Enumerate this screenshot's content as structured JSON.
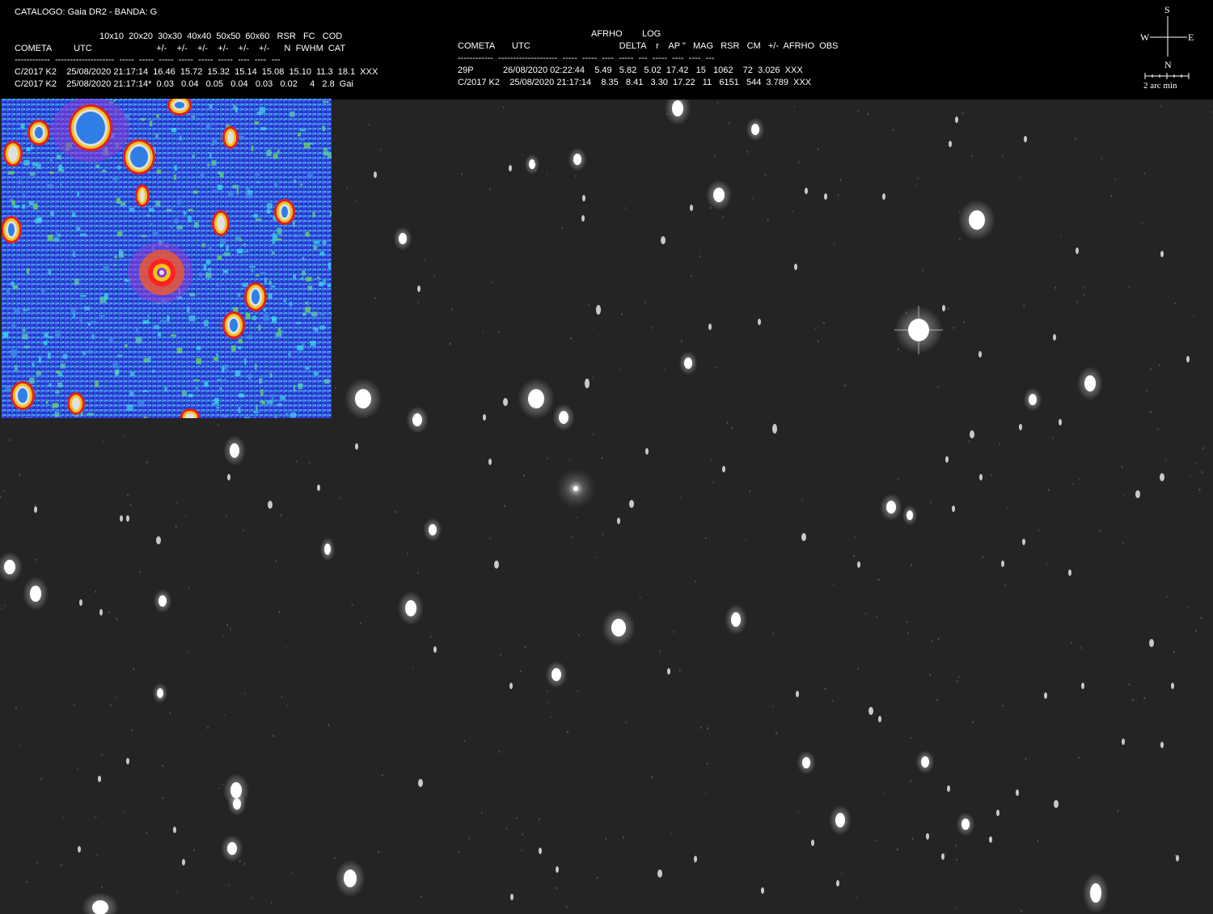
{
  "header": {
    "catalog_line": "CATALOGO: Gaia DR2 - BANDA: G",
    "left_table": {
      "header_row1": "10x10  20x20  30x30  40x40  50x50  60x60   RSR   FC   COD",
      "header_row2": "COMETA         UTC                          +/-    +/-    +/-    +/-    +/-    +/-      N  FWHM  CAT",
      "separator": "------------  --------------------  -----  -----  -----  -----  -----  -----  ----  ----  ---",
      "row1": "C/2017 K2    25/08/2020 21:17:14  16.46  15.72  15.32  15.14  15.08  15.10  11.3  18.1  XXX",
      "row2": "C/2017 K2    25/08/2020 21:17:14*  0.03   0.04   0.05   0.04   0.03   0.02     4   2.8  Gai"
    },
    "right_table": {
      "header_row1": "AFRHO        LOG",
      "header_row2": "COMETA       UTC                                    DELTA    r    AP \"   MAG   RSR   CM   +/-  AFRHO  OBS",
      "separator": "------------  --------------------  -----  -----  ----  -----  ---  -----  ----  ----  ---",
      "row1": "29P            26/08/2020 02:22:44    5.49   5.82   5.02  17.42   15   1062    72  3.026  XXX",
      "row2": "C/2017 K2    25/08/2020 21:17:14    8.35   8.41   3.30  17.22   11   6151   544  3.789  XXX"
    }
  },
  "compass": {
    "north": "N",
    "south": "S",
    "east": "E",
    "west": "W",
    "scale_label": "2 arc min"
  },
  "colors": {
    "background": "#000000",
    "sky": "#242424",
    "star": "#ffffff",
    "false_color_low": "#2f3fe0",
    "false_color_mid": "#41c0e0",
    "false_color_high": "#e02020"
  }
}
